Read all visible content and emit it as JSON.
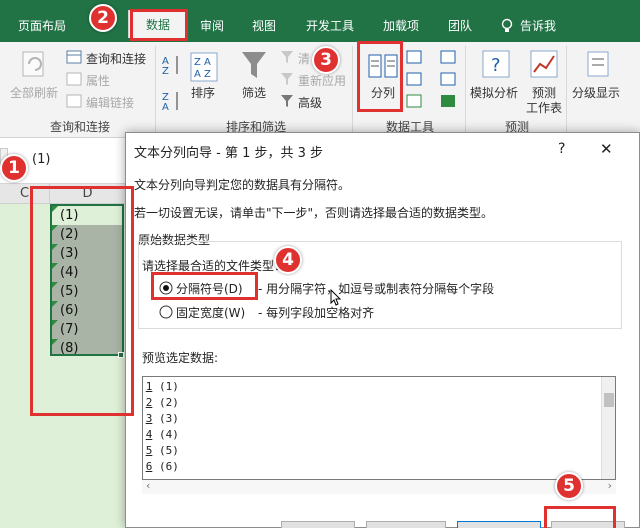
{
  "ribbon_tabs": [
    "页面布局",
    "数据",
    "审阅",
    "视图",
    "开发工具",
    "加载项",
    "团队",
    "告诉我"
  ],
  "ribbon": {
    "query_group": {
      "refresh_all": "全部刷新",
      "queries_connections": "查询和连接",
      "properties": "属性",
      "edit_links": "编辑链接",
      "label": "查询和连接"
    },
    "sort_group": {
      "sort": "排序",
      "filter": "筛选",
      "clear": "清",
      "reapply": "重新应用",
      "advanced": "高级",
      "label": "排序和筛选"
    },
    "tools_group": {
      "text_to_columns": "分列",
      "label": "数据工具"
    },
    "forecast_group": {
      "what_if": "模拟分析",
      "forecast_sheet_line1": "预测",
      "forecast_sheet_line2": "工作表",
      "label": "预测"
    },
    "outline_group": {
      "outline": "分级显示"
    }
  },
  "formula_bar": {
    "value": "(1)"
  },
  "sheet": {
    "col_c": "C",
    "col_d": "D",
    "cells": [
      "(1)",
      "(2)",
      "(3)",
      "(4)",
      "(5)",
      "(6)",
      "(7)",
      "(8)"
    ]
  },
  "dialog": {
    "title": "文本分列向导 - 第 1 步，共 3 步",
    "help": "?",
    "close": "✕",
    "line1": "文本分列向导判定您的数据具有分隔符。",
    "line2": "若一切设置无误，请单击\"下一步\"，否则请选择最合适的数据类型。",
    "section_label": "原始数据类型",
    "prompt": "请选择最合适的文件类型：",
    "option_delimited": "分隔符号(D)",
    "option_delimited_desc": "- 用分隔字符，如逗号或制表符分隔每个字段",
    "option_fixed": "固定宽度(W)",
    "option_fixed_desc": "- 每列字段加空格对齐",
    "preview_label": "预览选定数据:",
    "preview_rows": [
      {
        "n": "1",
        "v": "(1)"
      },
      {
        "n": "2",
        "v": "(2)"
      },
      {
        "n": "3",
        "v": "(3)"
      },
      {
        "n": "4",
        "v": "(4)"
      },
      {
        "n": "5",
        "v": "(5)"
      },
      {
        "n": "6",
        "v": "(6)"
      }
    ]
  },
  "annotations": [
    "1",
    "2",
    "3",
    "4",
    "5"
  ],
  "colors": {
    "excel_green": "#217346",
    "annotation_red": "#e03131",
    "sheet_bg": "#dff0d8"
  }
}
